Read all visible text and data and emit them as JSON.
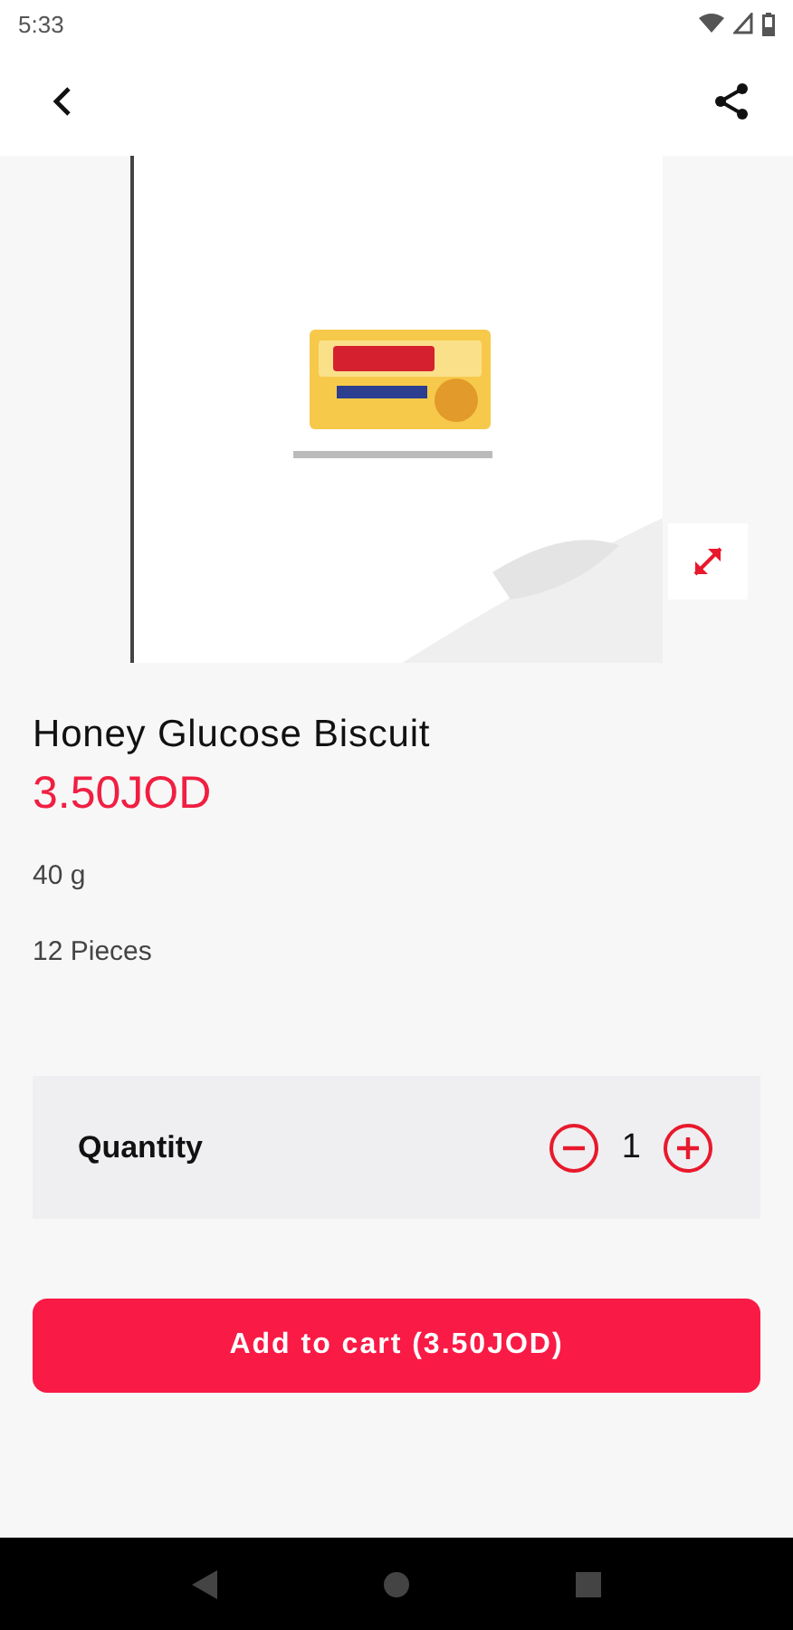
{
  "status_bar": {
    "time": "5:33"
  },
  "product": {
    "name": "Honey Glucose Biscuit",
    "price": "3.50JOD",
    "details": [
      "40 g",
      "12 Pieces"
    ]
  },
  "quantity": {
    "label": "Quantity",
    "value": "1"
  },
  "add_to_cart_button": "Add to cart (3.50JOD)"
}
